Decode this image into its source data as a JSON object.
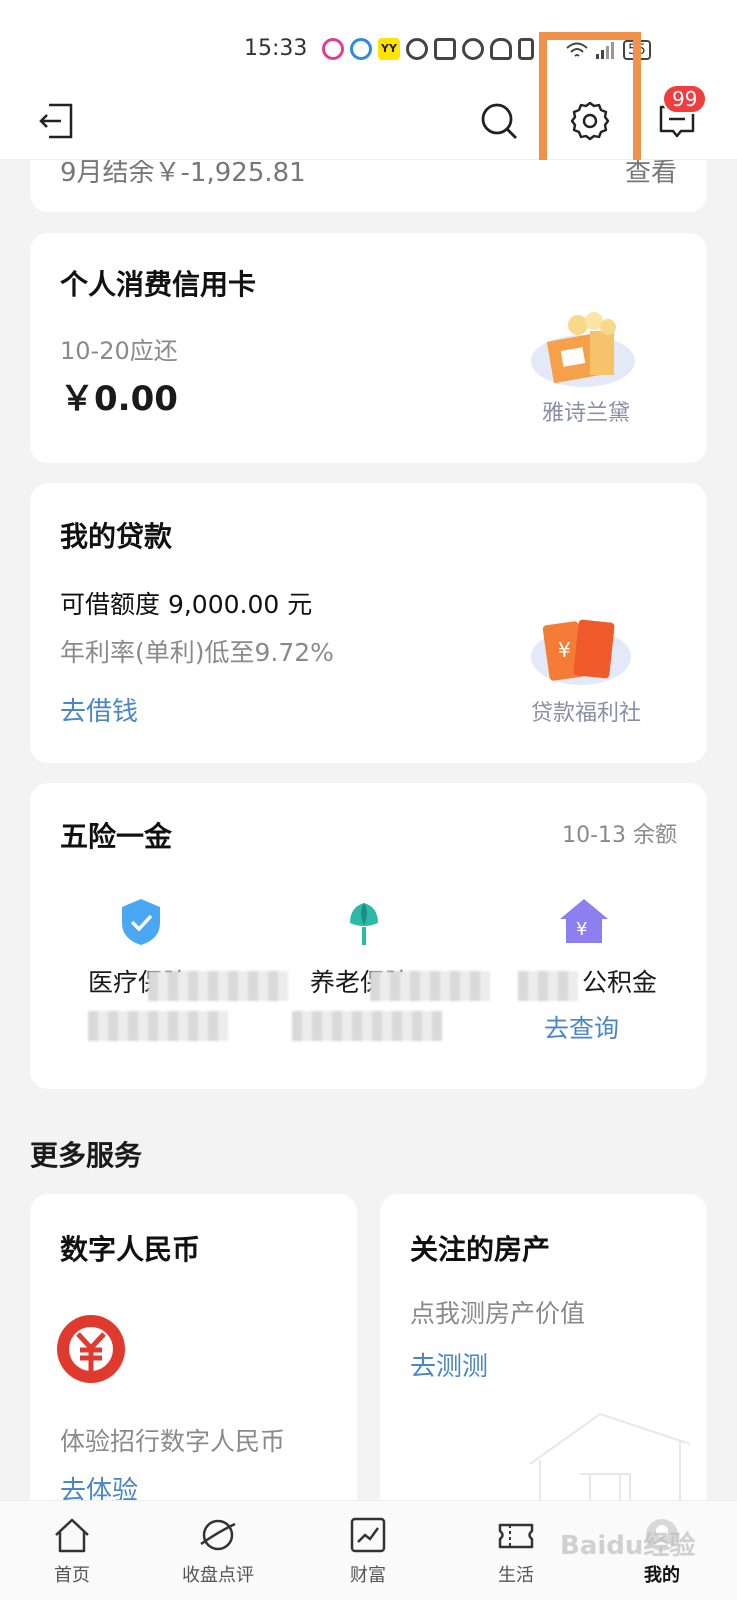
{
  "status": {
    "time": "15:33",
    "battery": "55"
  },
  "header": {
    "badge": "99"
  },
  "top_card": {
    "left_text": "9月结余￥-1,925.81",
    "right_text": "查看"
  },
  "credit_card": {
    "title": "个人消费信用卡",
    "due": "10-20应还",
    "amount": "￥0.00",
    "promo_label": "雅诗兰黛"
  },
  "loan": {
    "title": "我的贷款",
    "limit": "可借额度 9,000.00 元",
    "rate": "年利率(单利)低至9.72%",
    "action": "去借钱",
    "promo_label": "贷款福利社"
  },
  "insurance": {
    "title": "五险一金",
    "meta": "10-13 余额",
    "items": [
      {
        "label": "医疗保险",
        "icon": "shield-check-icon"
      },
      {
        "label": "养老保险",
        "icon": "tulip-icon"
      },
      {
        "label": "公积金",
        "action": "去查询",
        "icon": "house-yen-icon"
      }
    ]
  },
  "more_services": {
    "heading": "更多服务",
    "digital_rmb": {
      "title": "数字人民币",
      "desc": "体验招行数字人民币",
      "action": "去体验"
    },
    "property": {
      "title": "关注的房产",
      "desc": "点我测房产价值",
      "action": "去测测"
    }
  },
  "tabs": [
    {
      "label": "首页",
      "icon": "home-icon"
    },
    {
      "label": "收盘点评",
      "icon": "globe-icon"
    },
    {
      "label": "财富",
      "icon": "chart-icon"
    },
    {
      "label": "生活",
      "icon": "ticket-icon"
    },
    {
      "label": "我的",
      "icon": "profile-icon"
    }
  ],
  "watermark": "Baidu经验",
  "colors": {
    "accent_blue": "#4a86c8",
    "badge_red": "#f03d3d",
    "highlight_orange": "#f0924a"
  }
}
